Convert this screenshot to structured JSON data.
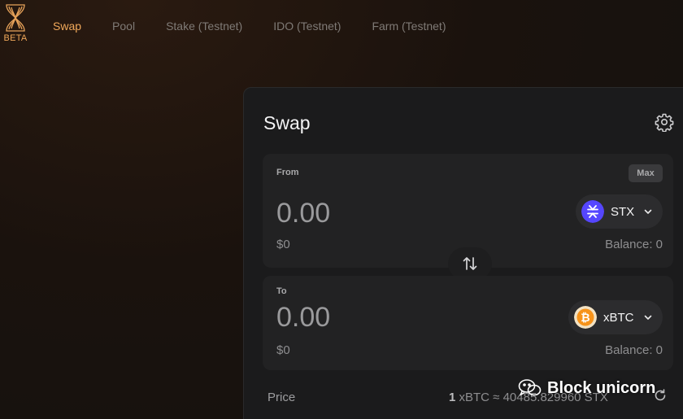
{
  "header": {
    "logo_icon": "hourglass-logo-icon",
    "beta_label": "BETA",
    "tabs": [
      {
        "label": "Swap",
        "active": true
      },
      {
        "label": "Pool",
        "active": false
      },
      {
        "label": "Stake (Testnet)",
        "active": false
      },
      {
        "label": "IDO (Testnet)",
        "active": false
      },
      {
        "label": "Farm (Testnet)",
        "active": false
      }
    ]
  },
  "swap": {
    "title": "Swap",
    "settings_icon": "gear-icon",
    "from": {
      "label": "From",
      "max_label": "Max",
      "amount": "0.00",
      "usd": "$0",
      "token": "STX",
      "token_color": "#5546ff",
      "balance": "Balance: 0"
    },
    "switch_icon": "swap-arrows-icon",
    "to": {
      "label": "To",
      "amount": "0.00",
      "usd": "$0",
      "token": "xBTC",
      "token_color": "#f7931a",
      "balance": "Balance: 0"
    },
    "price": {
      "label": "Price",
      "amount_prefix": "1",
      "text": "xBTC ≈ 40485.829960 STX"
    }
  },
  "watermark": {
    "text": "Block unicorn",
    "icon": "wechat-icon"
  },
  "colors": {
    "accent": "#f0a85a",
    "card_bg": "#1b1b1c",
    "panel_bg": "#222223"
  }
}
